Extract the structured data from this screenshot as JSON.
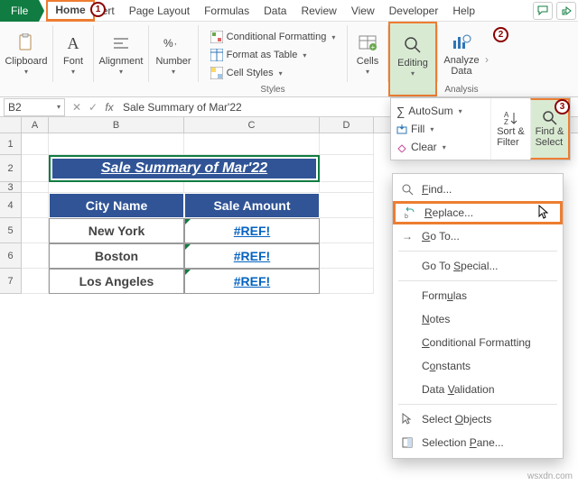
{
  "tabs": {
    "file": "File",
    "home": "Home",
    "insert": "ert",
    "pagelayout": "Page Layout",
    "formulas": "Formulas",
    "data": "Data",
    "review": "Review",
    "view": "View",
    "developer": "Developer",
    "help": "Help"
  },
  "groups": {
    "clipboard": "Clipboard",
    "font": "Font",
    "alignment": "Alignment",
    "number": "Number",
    "styles": "Styles",
    "cells": "Cells",
    "editing": "Editing",
    "analysis": "Analysis",
    "analyze_data": "Analyze\nData"
  },
  "styles_rows": {
    "cf": "Conditional Formatting",
    "fat": "Format as Table",
    "cs": "Cell Styles"
  },
  "editpanel": {
    "autosum": "AutoSum",
    "fill": "Fill",
    "clear": "Clear",
    "sortfilter": "Sort &\nFilter",
    "findselect": "Find &\nSelect"
  },
  "namebox": "B2",
  "formula": "Sale Summary of Mar'22",
  "cols": {
    "A": "A",
    "B": "B",
    "C": "C",
    "D": "D"
  },
  "rows_idx": [
    "1",
    "2",
    "3",
    "4",
    "5",
    "6",
    "7"
  ],
  "sheet": {
    "title": "Sale Summary of Mar'22",
    "h1": "City Name",
    "h2": "Sale Amount",
    "r1c1": "New York",
    "r1c2": "#REF!",
    "r2c1": "Boston",
    "r2c2": "#REF!",
    "r3c1": "Los Angeles",
    "r3c2": "#REF!"
  },
  "menu": {
    "find": "Find...",
    "replace": "Replace...",
    "goto": "Go To...",
    "gotospecial": "Go To Special...",
    "formulas": "Formulas",
    "notes": "Notes",
    "cf": "Conditional Formatting",
    "constants": "Constants",
    "dv": "Data Validation",
    "selobj": "Select Objects",
    "selpane": "Selection Pane..."
  },
  "callouts": {
    "c1": "1",
    "c2": "2",
    "c3": "3"
  },
  "watermark": "wsxdn.com"
}
